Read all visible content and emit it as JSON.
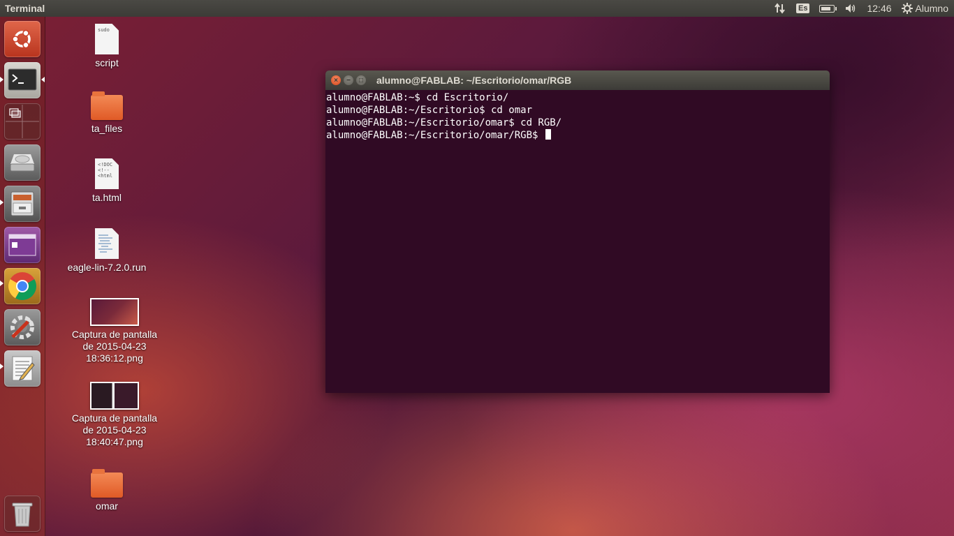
{
  "top_panel": {
    "app_title": "Terminal",
    "keyboard_layout": "Es",
    "battery_level": 0.8,
    "clock": "12:46",
    "user": "Alumno"
  },
  "launcher": {
    "items": [
      "dash-home",
      "terminal",
      "workspace-switcher",
      "disks",
      "file-cabinet",
      "image-viewer",
      "chrome",
      "system-settings",
      "text-editor",
      "trash"
    ]
  },
  "desktop": {
    "icons": [
      {
        "label": "script",
        "thumb_text": "sudo"
      },
      {
        "label": "ta_files"
      },
      {
        "label": "ta.html",
        "thumb_text": "<!DOC\n<!--\n<html"
      },
      {
        "label": "eagle-lin-7.2.0.run"
      },
      {
        "label_lines": [
          "Captura de pantalla",
          "de 2015-04-23",
          "18:36:12.png"
        ]
      },
      {
        "label_lines": [
          "Captura de pantalla",
          "de 2015-04-23",
          "18:40:47.png"
        ]
      },
      {
        "label": "omar"
      }
    ]
  },
  "terminal": {
    "title": "alumno@FABLAB: ~/Escritorio/omar/RGB",
    "lines": [
      "alumno@FABLAB:~$ cd Escritorio/",
      "alumno@FABLAB:~/Escritorio$ cd omar",
      "alumno@FABLAB:~/Escritorio/omar$ cd RGB/",
      "alumno@FABLAB:~/Escritorio/omar/RGB$ "
    ]
  },
  "colors": {
    "terminal_bg": "#300a24",
    "panel_bg": "#3c3b37",
    "close_button": "#df4a16",
    "folder_orange": "#e8733d"
  }
}
